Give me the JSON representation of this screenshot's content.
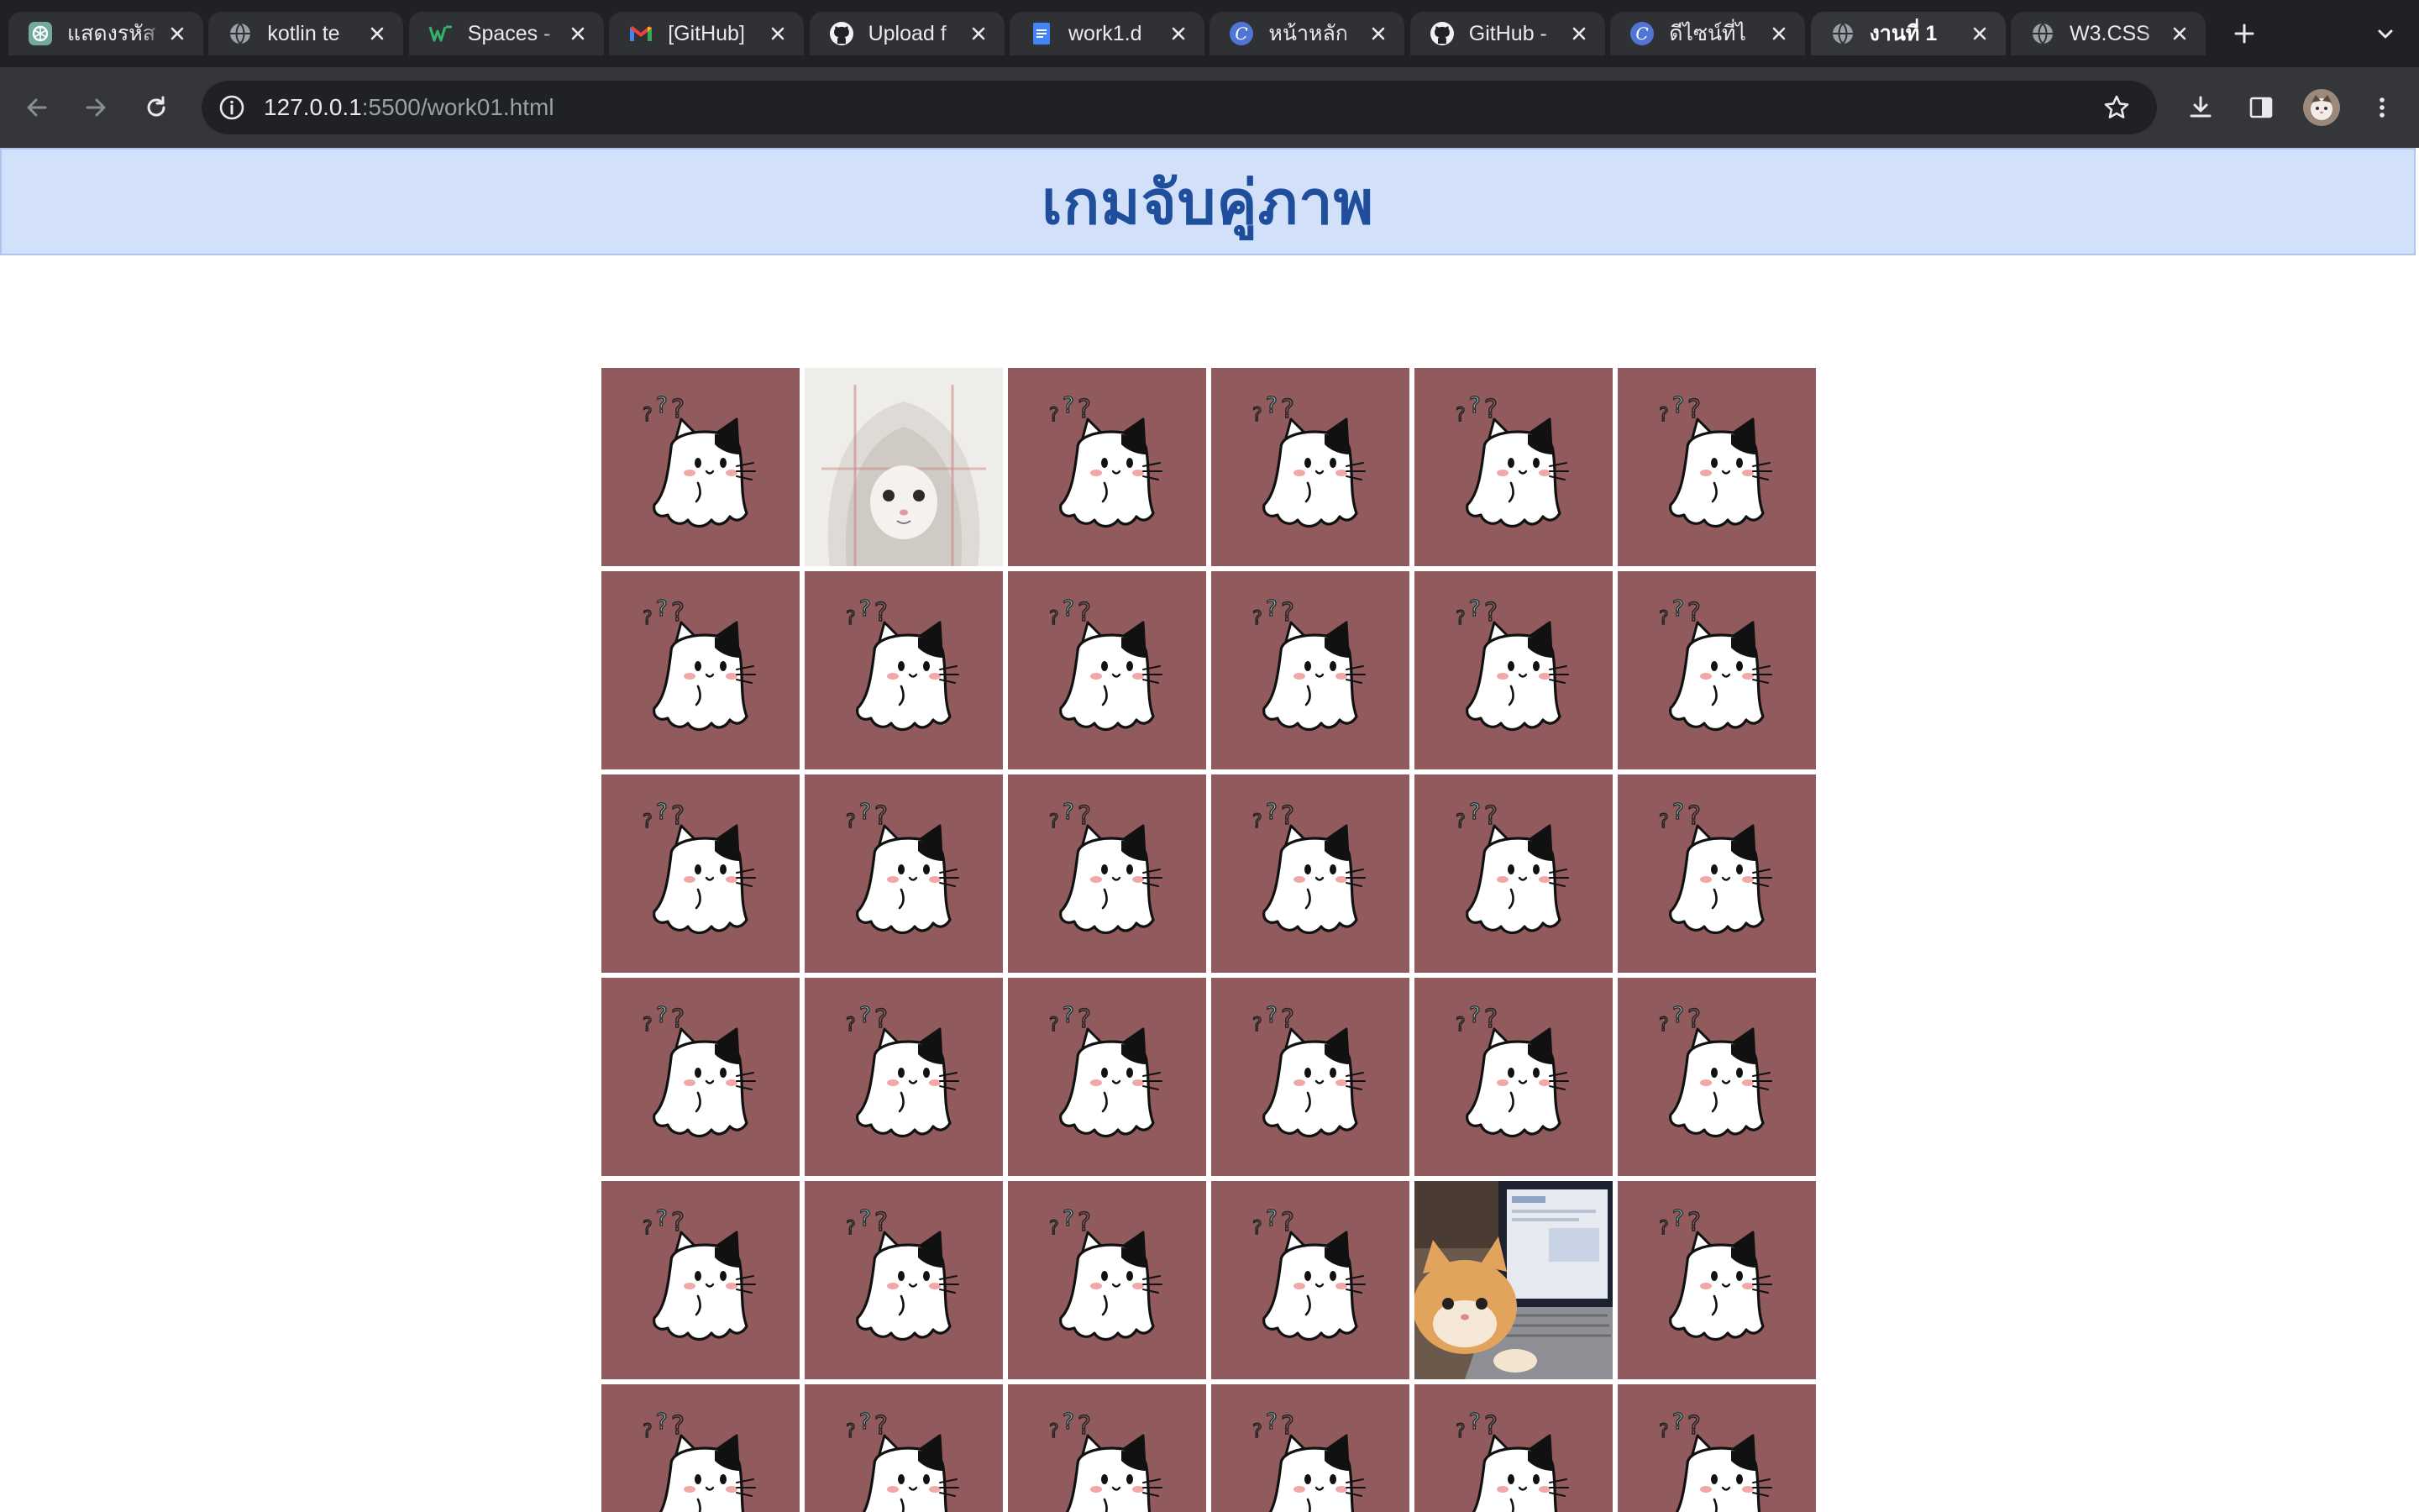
{
  "browser": {
    "tabs": [
      {
        "title": "แสดงรหัส",
        "favicon": "chatgpt-icon",
        "active": false
      },
      {
        "title": "kotlin te",
        "favicon": "globe-icon",
        "active": false
      },
      {
        "title": "Spaces -",
        "favicon": "w-logo-icon",
        "active": false
      },
      {
        "title": "[GitHub]",
        "favicon": "gmail-icon",
        "active": false
      },
      {
        "title": "Upload f",
        "favicon": "github-icon",
        "active": false
      },
      {
        "title": "work1.d",
        "favicon": "docs-icon",
        "active": false
      },
      {
        "title": "หน้าหลัก",
        "favicon": "canva-icon",
        "active": false
      },
      {
        "title": "GitHub -",
        "favicon": "github-icon",
        "active": false
      },
      {
        "title": "ดีไซน์ที่ไ",
        "favicon": "canva-icon",
        "active": false
      },
      {
        "title": "งานที่ 1",
        "favicon": "globe-icon",
        "active": true
      },
      {
        "title": "W3.CSS",
        "favicon": "globe-icon",
        "active": false
      }
    ],
    "url_host": "127.0.0.1",
    "url_path": ":5500/work01.html"
  },
  "page": {
    "title": "เกมจับคู่ภาพ",
    "grid_columns": 6,
    "card_back_color": "#915b5d",
    "cards": [
      {
        "state": "hidden",
        "image": "ghost-cat"
      },
      {
        "state": "revealed",
        "image": "cat-in-blanket-photo"
      },
      {
        "state": "hidden",
        "image": "ghost-cat"
      },
      {
        "state": "hidden",
        "image": "ghost-cat"
      },
      {
        "state": "hidden",
        "image": "ghost-cat"
      },
      {
        "state": "hidden",
        "image": "ghost-cat"
      },
      {
        "state": "hidden",
        "image": "ghost-cat"
      },
      {
        "state": "hidden",
        "image": "ghost-cat"
      },
      {
        "state": "hidden",
        "image": "ghost-cat"
      },
      {
        "state": "hidden",
        "image": "ghost-cat"
      },
      {
        "state": "hidden",
        "image": "ghost-cat"
      },
      {
        "state": "hidden",
        "image": "ghost-cat"
      },
      {
        "state": "hidden",
        "image": "ghost-cat"
      },
      {
        "state": "hidden",
        "image": "ghost-cat"
      },
      {
        "state": "hidden",
        "image": "ghost-cat"
      },
      {
        "state": "hidden",
        "image": "ghost-cat"
      },
      {
        "state": "hidden",
        "image": "ghost-cat"
      },
      {
        "state": "hidden",
        "image": "ghost-cat"
      },
      {
        "state": "hidden",
        "image": "ghost-cat"
      },
      {
        "state": "hidden",
        "image": "ghost-cat"
      },
      {
        "state": "hidden",
        "image": "ghost-cat"
      },
      {
        "state": "hidden",
        "image": "ghost-cat"
      },
      {
        "state": "hidden",
        "image": "ghost-cat"
      },
      {
        "state": "hidden",
        "image": "ghost-cat"
      },
      {
        "state": "hidden",
        "image": "ghost-cat"
      },
      {
        "state": "hidden",
        "image": "ghost-cat"
      },
      {
        "state": "hidden",
        "image": "ghost-cat"
      },
      {
        "state": "hidden",
        "image": "ghost-cat"
      },
      {
        "state": "revealed",
        "image": "cat-with-laptop-photo"
      },
      {
        "state": "hidden",
        "image": "ghost-cat"
      },
      {
        "state": "hidden",
        "image": "ghost-cat"
      },
      {
        "state": "hidden",
        "image": "ghost-cat"
      },
      {
        "state": "hidden",
        "image": "ghost-cat"
      },
      {
        "state": "hidden",
        "image": "ghost-cat"
      },
      {
        "state": "hidden",
        "image": "ghost-cat"
      },
      {
        "state": "hidden",
        "image": "ghost-cat"
      }
    ]
  }
}
